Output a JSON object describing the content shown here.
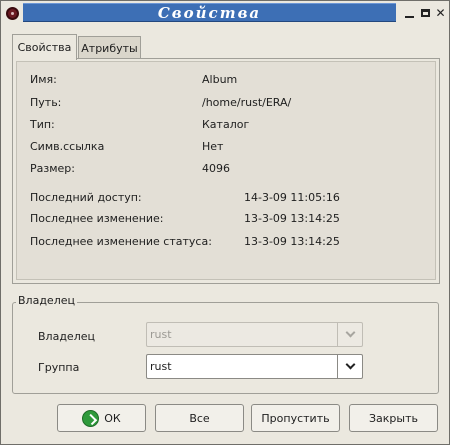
{
  "window": {
    "title": "Свойства"
  },
  "tabs": [
    {
      "label": "Свойства",
      "active": true
    },
    {
      "label": "Атрибуты",
      "active": false
    }
  ],
  "properties": {
    "name_label": "Имя:",
    "name_value": "Album",
    "path_label": "Путь:",
    "path_value": "/home/rust/ERA/",
    "type_label": "Тип:",
    "type_value": "Каталог",
    "symlink_label": "Симв.ссылка",
    "symlink_value": "Нет",
    "size_label": "Размер:",
    "size_value": "4096",
    "last_access_label": "Последний доступ:",
    "last_access_value": "14-3-09 11:05:16",
    "last_modified_label": "Последнее изменение:",
    "last_modified_value": "13-3-09 13:14:25",
    "last_status_change_label": "Последнее изменение статуса:",
    "last_status_change_value": "13-3-09 13:14:25"
  },
  "owner_group": {
    "title": "Владелец",
    "owner_label": "Владелец",
    "owner_value": "rust",
    "group_label": "Группа",
    "group_value": "rust"
  },
  "buttons": {
    "ok": "ОК",
    "all": "Все",
    "skip": "Пропустить",
    "close": "Закрыть"
  },
  "colors": {
    "title_band": "#3d6fb5",
    "window_bg": "#ebe8df",
    "ok_icon": "#2f9a3b"
  },
  "icons": {
    "app": "app-menu-icon",
    "minimize": "minimize-icon",
    "maximize": "maximize-icon",
    "close": "close-icon",
    "ok": "ok-check-icon",
    "dropdown": "chevron-down-icon"
  }
}
